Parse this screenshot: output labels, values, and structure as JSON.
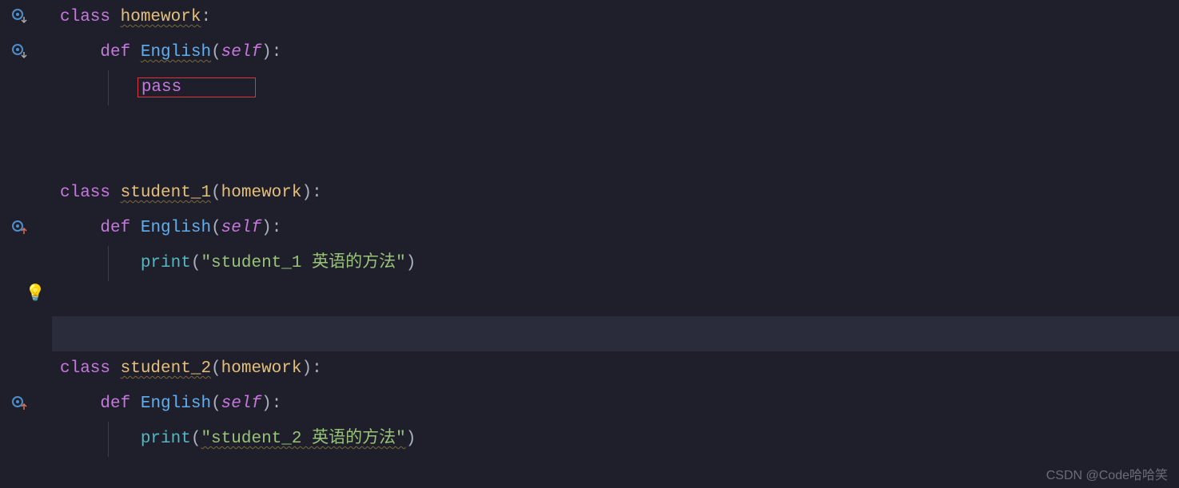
{
  "code": {
    "l1_class": "class ",
    "l1_name": "homework",
    "l1_colon": ":",
    "l2_indent": "    ",
    "l2_def": "def ",
    "l2_fn": "English",
    "l2_open": "(",
    "l2_self": "self",
    "l2_close": "):",
    "l3_indent": "        ",
    "l3_pass": "pass",
    "l3_pass_pad": "       ",
    "l6_class": "class ",
    "l6_name": "student_1",
    "l6_open": "(",
    "l6_base": "homework",
    "l6_close": "):",
    "l7_indent": "    ",
    "l7_def": "def ",
    "l7_fn": "English",
    "l7_open": "(",
    "l7_self": "self",
    "l7_close": "):",
    "l8_indent": "        ",
    "l8_print": "print",
    "l8_open": "(",
    "l8_str": "\"student_1 英语的方法\"",
    "l8_close": ")",
    "l11_class": "class ",
    "l11_name": "student_2",
    "l11_open": "(",
    "l11_base": "homework",
    "l11_close": "):",
    "l12_indent": "    ",
    "l12_def": "def ",
    "l12_fn": "English",
    "l12_open": "(",
    "l12_self": "self",
    "l12_close": "):",
    "l13_indent": "        ",
    "l13_print": "print",
    "l13_open": "(",
    "l13_str": "\"student_2 英语的方法\"",
    "l13_close": ")"
  },
  "watermark": "CSDN @Code哈哈笑",
  "icons": {
    "override_down": "override-down-icon",
    "override_up": "override-up-icon",
    "bulb": "lightbulb-icon"
  }
}
